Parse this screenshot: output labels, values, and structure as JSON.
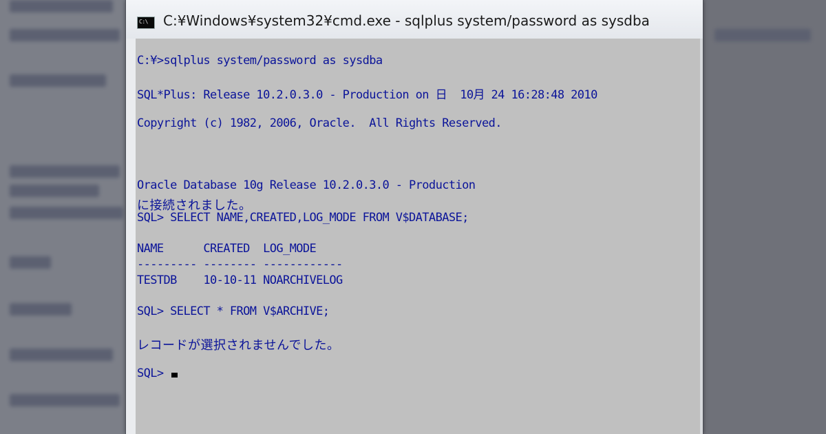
{
  "window": {
    "title": "C:¥Windows¥system32¥cmd.exe - sqlplus  system/password as sysdba",
    "icon_label": "C:\\"
  },
  "console": {
    "lines": [
      "C:¥>sqlplus system/password as sysdba",
      "SQL*Plus: Release 10.2.0.3.0 - Production on 日  10月 24 16:28:48 2010",
      "Copyright (c) 1982, 2006, Oracle.  All Rights Reserved.",
      "Oracle Database 10g Release 10.2.0.3.0 - Production",
      "に接続されました。",
      "SQL> SELECT NAME,CREATED,LOG_MODE FROM V$DATABASE;",
      "NAME      CREATED  LOG_MODE",
      "--------- -------- ------------",
      "TESTDB    10-10-11 NOARCHIVELOG",
      "SQL> SELECT * FROM V$ARCHIVE;",
      "レコードが選択されませんでした。",
      "SQL> "
    ]
  },
  "colors": {
    "console_bg": "#c0c0c0",
    "console_text": "#0b1499",
    "titlebar_bg": "#eaecef"
  }
}
